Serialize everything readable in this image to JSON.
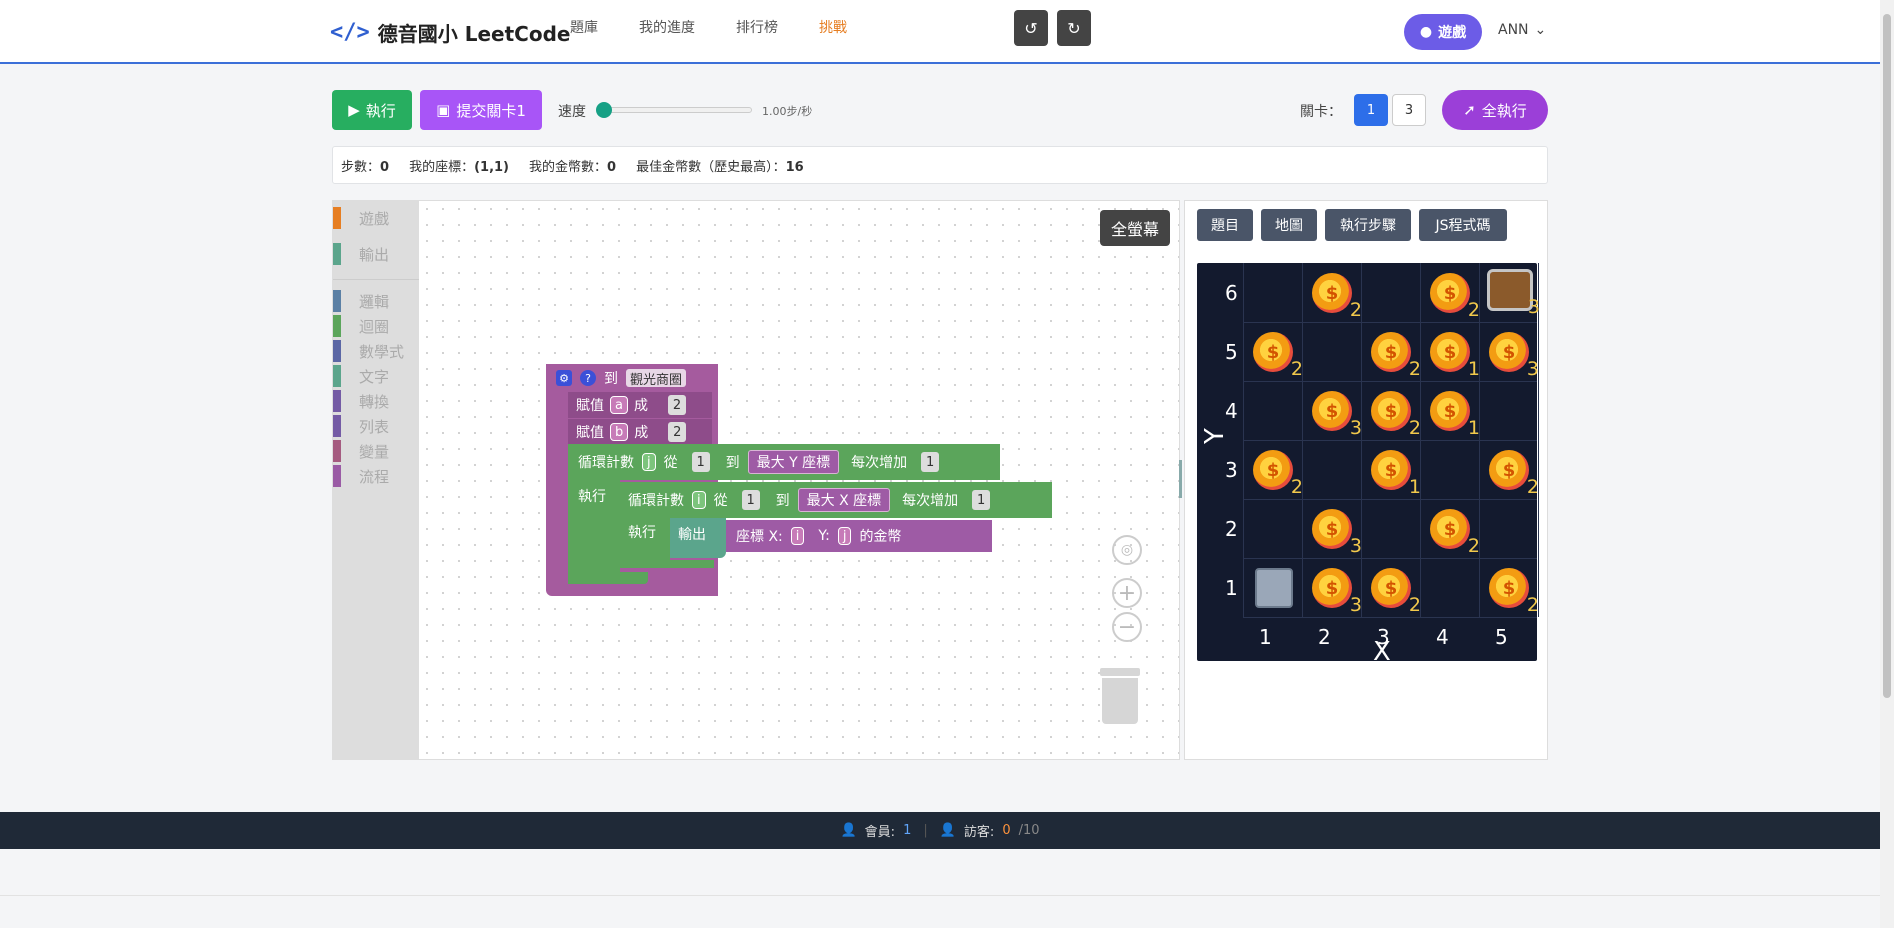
{
  "header": {
    "brand_icon": "</>",
    "brand": "德音國小 LeetCode",
    "nav": [
      "題庫",
      "我的進度",
      "排行榜",
      "挑戰"
    ],
    "game_button": "遊戲",
    "user": "ANN"
  },
  "toolbar": {
    "run": "執行",
    "submit": "提交關卡1",
    "speed_label": "速度",
    "speed_value": "1.00步/秒",
    "speed_fraction": 0.0,
    "level_label": "關卡：",
    "levels": [
      "1",
      "3"
    ],
    "run_all": "全執行"
  },
  "stats": {
    "steps_label": "步數：",
    "steps": "0",
    "coord_label": "我的座標：",
    "coord": "(1,1)",
    "coins_label": "我的金幣數：",
    "coins": "0",
    "best_label": "最佳金幣數（歷史最高）：",
    "best": "16"
  },
  "toolbox": {
    "categories": [
      {
        "label": "遊戲",
        "color": "#e67e22"
      },
      {
        "label": "輸出",
        "color": "#5ba58c"
      },
      {
        "label": "邏輯",
        "color": "#5b80a5"
      },
      {
        "label": "迴圈",
        "color": "#5ba55b"
      },
      {
        "label": "數學式",
        "color": "#5b67a5"
      },
      {
        "label": "文字",
        "color": "#5ba58c"
      },
      {
        "label": "轉換",
        "color": "#745ba5"
      },
      {
        "label": "列表",
        "color": "#745ba5"
      },
      {
        "label": "變量",
        "color": "#a55b80"
      },
      {
        "label": "流程",
        "color": "#9a5ba5"
      }
    ]
  },
  "workspace": {
    "undo": "↺",
    "redo": "↻",
    "fullscreen": "全螢幕",
    "zoom_in": "+",
    "zoom_out": "−",
    "blocks": {
      "func_to": "到",
      "func_name": "觀光商圈",
      "set1": "賦值",
      "var_a": "a",
      "to1": "成",
      "val_a": "2",
      "set2": "賦值",
      "var_b": "b",
      "to2": "成",
      "val_b": "2",
      "loop1": "循環計數",
      "loop1_var": "j",
      "from1": "從",
      "from1_val": "1",
      "to3": "到",
      "max_y": "最大 Y 座標",
      "step1": "每次增加",
      "step1_val": "1",
      "do1": "執行",
      "loop2": "循環計數",
      "loop2_var": "i",
      "from2": "從",
      "from2_val": "1",
      "to4": "到",
      "max_x": "最大 X 座標",
      "step2": "每次增加",
      "step2_val": "1",
      "do2": "執行",
      "output": "輸出",
      "coord_x_label": "座標  X:",
      "coord_x": "i",
      "coord_y_label": "Y:",
      "coord_y": "j",
      "coin_of": "的金幣"
    }
  },
  "panel": {
    "tabs": [
      "題目",
      "地圖",
      "執行步驟",
      "JS程式碼"
    ],
    "map": {
      "y_labels": [
        "6",
        "5",
        "4",
        "3",
        "2",
        "1"
      ],
      "x_labels": [
        "1",
        "2",
        "3",
        "4",
        "5"
      ],
      "axis_x": "X",
      "axis_y": "Y",
      "coins": [
        {
          "x": 2,
          "y": 6,
          "count": "2"
        },
        {
          "x": 4,
          "y": 6,
          "count": "2"
        },
        {
          "x": 1,
          "y": 5,
          "count": "2"
        },
        {
          "x": 3,
          "y": 5,
          "count": "2"
        },
        {
          "x": 4,
          "y": 5,
          "count": "1"
        },
        {
          "x": 5,
          "y": 5,
          "count": "3"
        },
        {
          "x": 2,
          "y": 4,
          "count": "3"
        },
        {
          "x": 3,
          "y": 4,
          "count": "2"
        },
        {
          "x": 4,
          "y": 4,
          "count": "1"
        },
        {
          "x": 1,
          "y": 3,
          "count": "2"
        },
        {
          "x": 3,
          "y": 3,
          "count": "1"
        },
        {
          "x": 5,
          "y": 3,
          "count": "2"
        },
        {
          "x": 2,
          "y": 2,
          "count": "3"
        },
        {
          "x": 4,
          "y": 2,
          "count": "2"
        },
        {
          "x": 2,
          "y": 1,
          "count": "3"
        },
        {
          "x": 3,
          "y": 1,
          "count": "2"
        },
        {
          "x": 5,
          "y": 1,
          "count": "2"
        }
      ],
      "chest": {
        "x": 5,
        "y": 6,
        "count": "3"
      },
      "robot": {
        "x": 1,
        "y": 1
      }
    }
  },
  "footer": {
    "member_label": "會員:",
    "members": "1",
    "visitor_label": "訪客:",
    "visitors": "0",
    "visitor_max": "/10"
  }
}
